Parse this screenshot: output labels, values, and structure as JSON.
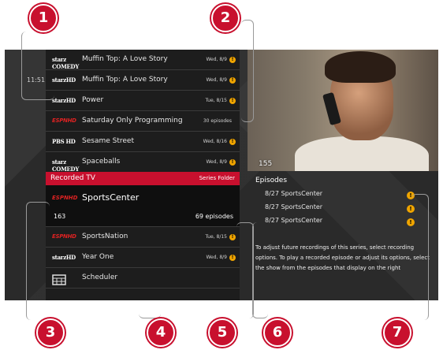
{
  "clock": "11:51",
  "rows_top": [
    {
      "logo": "starz COMEDY",
      "title": "Muffin Top: A Love Story",
      "meta": "Wed, 8/9",
      "warn": true
    },
    {
      "logo": "starzHD",
      "title": "Muffin Top: A Love Story",
      "meta": "Wed, 8/9",
      "warn": true
    },
    {
      "logo": "starzHD",
      "title": "Power",
      "meta": "Tue, 8/15",
      "warn": true
    },
    {
      "logo": "ESPNHD",
      "title": "Saturday Only Programming",
      "meta": "30 episodes",
      "warn": false
    },
    {
      "logo": "PBS HD",
      "title": "Sesame Street",
      "meta": "Wed, 8/16",
      "warn": true
    },
    {
      "logo": "starz COMEDY",
      "title": "Spaceballs",
      "meta": "Wed, 8/9",
      "warn": true
    }
  ],
  "folder_bar": {
    "label": "Recorded TV",
    "right": "Series Folder"
  },
  "selected": {
    "logo": "ESPNHD",
    "title": "SportsCenter",
    "number": "163",
    "episodes": "69 episodes"
  },
  "rows_bottom": [
    {
      "logo": "ESPNHD",
      "title": "SportsNation",
      "meta": "Tue, 8/15",
      "warn": true
    },
    {
      "logo": "starzHD",
      "title": "Year One",
      "meta": "Wed, 8/9",
      "warn": true
    },
    {
      "logo": "",
      "title": "Scheduler",
      "meta": "",
      "warn": false
    }
  ],
  "video": {
    "channel_number": "155"
  },
  "episodes_panel": {
    "header": "Episodes",
    "items": [
      "8/27  SportsCenter",
      "8/27  SportsCenter",
      "8/27  SportsCenter"
    ],
    "help": "To adjust future recordings of this series, select recording options. To play a recorded episode or adjust its options, select the show from the episodes that display on the right"
  },
  "callouts": [
    "1",
    "2",
    "3",
    "4",
    "5",
    "6",
    "7"
  ],
  "colors": {
    "accent": "#c8102e",
    "warning": "#f0a500"
  }
}
